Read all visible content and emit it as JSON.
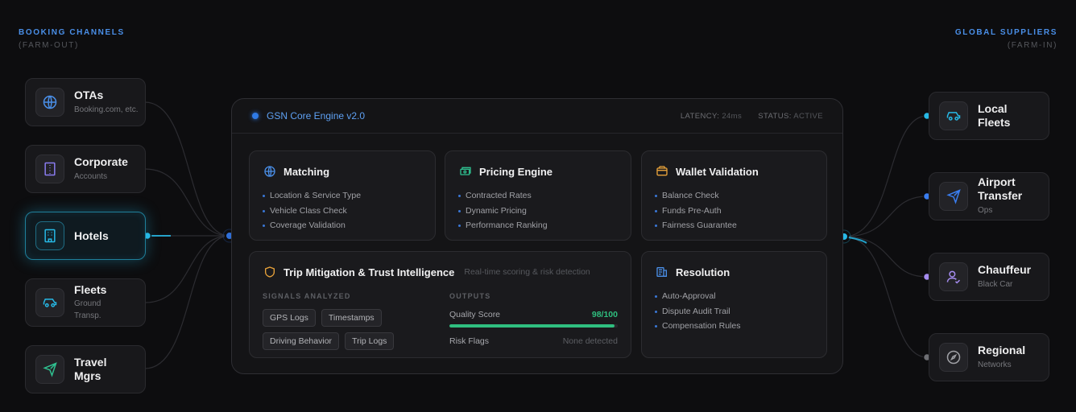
{
  "left_header": {
    "title": "BOOKING CHANNELS",
    "subtitle": "(FARM-OUT)"
  },
  "right_header": {
    "title": "GLOBAL SUPPLIERS",
    "subtitle": "(FARM-IN)"
  },
  "channels": [
    {
      "title": "OTAs",
      "sub": "Booking.com, etc.",
      "icon": "globe-icon",
      "color": "#4a8fe8",
      "active": false
    },
    {
      "title": "Corporate",
      "sub": "Accounts",
      "icon": "building-icon",
      "color": "#8a7cf0",
      "active": false
    },
    {
      "title": "Hotels",
      "sub": "",
      "icon": "hotel-icon",
      "color": "#27b9e6",
      "active": true
    },
    {
      "title": "Fleets",
      "sub": "Ground Transp.",
      "icon": "car-icon",
      "color": "#27b9e6",
      "active": false
    },
    {
      "title": "Travel Mgrs",
      "sub": "",
      "icon": "plane-icon",
      "color": "#2fbf8f",
      "active": false
    }
  ],
  "suppliers": [
    {
      "title": "Local Fleets",
      "sub": "",
      "icon": "car-icon",
      "color": "#27b9e6",
      "dot": "#27b9e6"
    },
    {
      "title": "Airport Transfer",
      "sub": "Ops",
      "icon": "plane-icon",
      "color": "#3a7ef0",
      "dot": "#3a7ef0"
    },
    {
      "title": "Chauffeur",
      "sub": "Black Car",
      "icon": "user-check-icon",
      "color": "#a58cf0",
      "dot": "#a58cf0"
    },
    {
      "title": "Regional",
      "sub": "Networks",
      "icon": "compass-icon",
      "color": "#a0a1a6",
      "dot": "#6d6e73"
    }
  ],
  "engine": {
    "title": "GSN Core Engine v2.0",
    "latency_label": "LATENCY:",
    "latency_value": "24ms",
    "status_label": "STATUS:",
    "status_value": "ACTIVE",
    "modules": {
      "matching": {
        "title": "Matching",
        "icon": "globe-icon",
        "color": "#4a8fe8",
        "items": [
          "Location & Service Type",
          "Vehicle Class Check",
          "Coverage Validation"
        ]
      },
      "pricing": {
        "title": "Pricing Engine",
        "icon": "money-icon",
        "color": "#2fbf8f",
        "items": [
          "Contracted Rates",
          "Dynamic Pricing",
          "Performance Ranking"
        ]
      },
      "wallet": {
        "title": "Wallet Validation",
        "icon": "wallet-icon",
        "color": "#e8a23a",
        "items": [
          "Balance Check",
          "Funds Pre-Auth",
          "Fairness Guarantee"
        ]
      },
      "trust": {
        "title": "Trip Mitigation & Trust Intelligence",
        "subtitle": "Real-time scoring & risk detection",
        "icon": "shield-icon",
        "color": "#e8a23a",
        "signals_label": "SIGNALS ANALYZED",
        "signals": [
          "GPS Logs",
          "Timestamps",
          "Driving Behavior",
          "Trip Logs"
        ],
        "outputs_label": "OUTPUTS",
        "quality_label": "Quality Score",
        "quality_value": "98/100",
        "quality_fraction": 0.98,
        "risk_label": "Risk Flags",
        "risk_value": "None detected"
      },
      "resolution": {
        "title": "Resolution",
        "icon": "document-icon",
        "color": "#4a8fe8",
        "items": [
          "Auto-Approval",
          "Dispute Audit Trail",
          "Compensation Rules"
        ]
      }
    }
  }
}
